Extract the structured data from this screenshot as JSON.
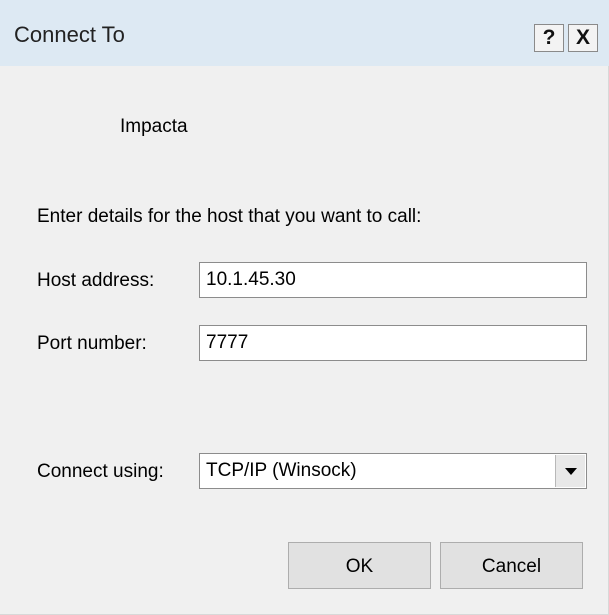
{
  "window": {
    "title": "Connect To",
    "help_label": "?",
    "close_label": "X"
  },
  "connection": {
    "name": "Impacta",
    "instructions": "Enter details for the host that you want to call:"
  },
  "host": {
    "label": "Host address:",
    "value": "10.1.45.30"
  },
  "port": {
    "label": "Port number:",
    "value": "7777"
  },
  "connect_using": {
    "label": "Connect using:",
    "selected": "TCP/IP (Winsock)"
  },
  "buttons": {
    "ok": "OK",
    "cancel": "Cancel"
  }
}
